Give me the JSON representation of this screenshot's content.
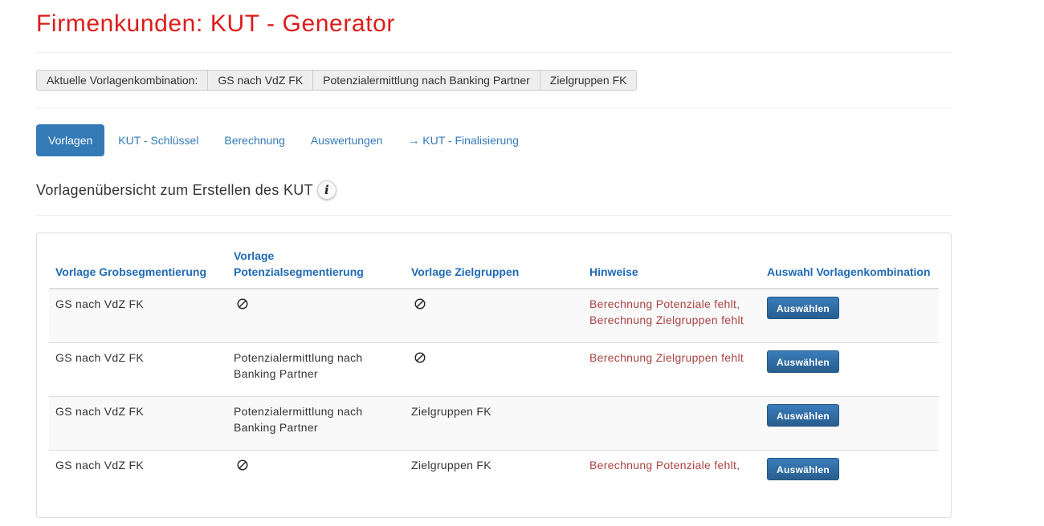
{
  "page": {
    "title": "Firmenkunden: KUT - Generator"
  },
  "combination": {
    "label": "Aktuelle Vorlagenkombination:",
    "items": [
      "GS nach VdZ FK",
      "Potenzialermittlung nach Banking Partner",
      "Zielgruppen FK"
    ]
  },
  "nav": {
    "tabs": [
      {
        "label": "Vorlagen",
        "active": true
      },
      {
        "label": "KUT - Schlüssel",
        "active": false
      },
      {
        "label": "Berechnung",
        "active": false
      },
      {
        "label": "Auswertungen",
        "active": false
      },
      {
        "label": "→ KUT - Finalisierung",
        "active": false
      }
    ]
  },
  "section": {
    "title": "Vorlagenübersicht zum Erstellen des KUT",
    "info_icon": "info-icon"
  },
  "table": {
    "headers": {
      "grob": "Vorlage Grobsegmentierung",
      "potenzial": "Vorlage Potenzialsegmentierung",
      "zielgruppen": "Vorlage Zielgruppen",
      "hinweise": "Hinweise",
      "auswahl": "Auswahl Vorlagenkombination"
    },
    "empty_icon": "not-available-icon",
    "hint_color": "#a94442",
    "rows": [
      {
        "grob": "GS nach VdZ FK",
        "potenzial": "",
        "zielgruppen": "",
        "hinweise": "Berechnung Potenziale fehlt, Berechnung Zielgruppen fehlt",
        "button": "Auswählen"
      },
      {
        "grob": "GS nach VdZ FK",
        "potenzial": "Potenzialermittlung nach Banking Partner",
        "zielgruppen": "",
        "hinweise": "Berechnung Zielgruppen fehlt",
        "button": "Auswählen"
      },
      {
        "grob": "GS nach VdZ FK",
        "potenzial": "Potenzialermittlung nach Banking Partner",
        "zielgruppen": "Zielgruppen FK",
        "hinweise": "",
        "button": "Auswählen"
      },
      {
        "grob": "GS nach VdZ FK",
        "potenzial": "",
        "zielgruppen": "Zielgruppen FK",
        "hinweise": "Berechnung Potenziale fehlt,",
        "button": "Auswählen"
      }
    ]
  },
  "colors": {
    "title": "#dd1c1a",
    "primary": "#337ab7",
    "header_text": "#1f6ab4",
    "button": "#2d6ca2"
  }
}
